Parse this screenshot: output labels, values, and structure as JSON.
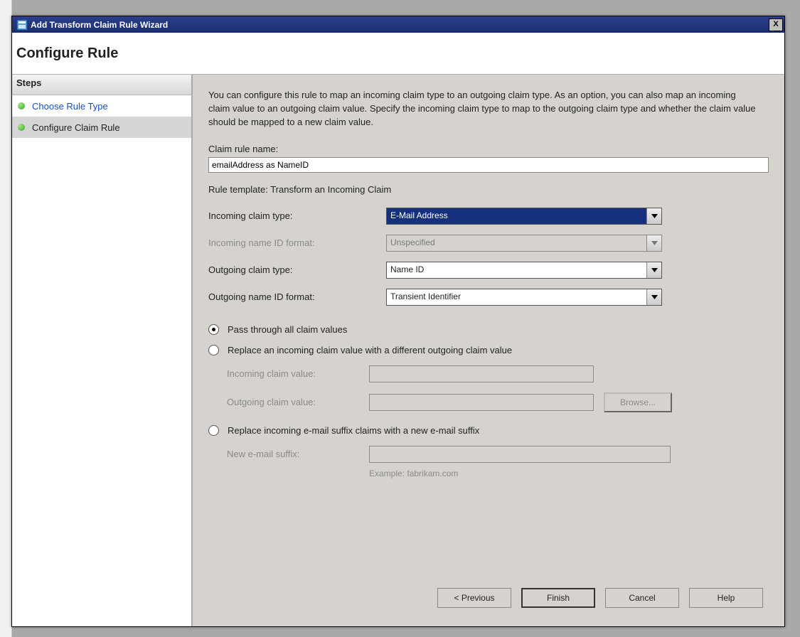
{
  "window": {
    "title": "Add Transform Claim Rule Wizard",
    "close_glyph": "X"
  },
  "header": {
    "title": "Configure Rule"
  },
  "sidebar": {
    "heading": "Steps",
    "items": [
      {
        "label": "Choose Rule Type"
      },
      {
        "label": "Configure Claim Rule"
      }
    ]
  },
  "main": {
    "intro": "You can configure this rule to map an incoming claim type to an outgoing claim type. As an option, you can also map an incoming claim value to an outgoing claim value. Specify the incoming claim type to map to the outgoing claim type and whether the claim value should be mapped to a new claim value.",
    "rule_name_label": "Claim rule name:",
    "rule_name_value": "emailAddress as NameID",
    "template_line": "Rule template: Transform an Incoming Claim",
    "incoming_type_label": "Incoming claim type:",
    "incoming_type_value": "E-Mail Address",
    "incoming_format_label": "Incoming name ID format:",
    "incoming_format_value": "Unspecified",
    "outgoing_type_label": "Outgoing claim type:",
    "outgoing_type_value": "Name ID",
    "outgoing_format_label": "Outgoing name ID format:",
    "outgoing_format_value": "Transient Identifier",
    "radios": {
      "pass": "Pass through all claim values",
      "replace_value": "Replace an incoming claim value with a different outgoing claim value",
      "replace_suffix": "Replace incoming e-mail suffix claims with a new e-mail suffix"
    },
    "replace": {
      "incoming_label": "Incoming claim value:",
      "outgoing_label": "Outgoing claim value:",
      "browse_label": "Browse..."
    },
    "suffix": {
      "label": "New e-mail suffix:",
      "example": "Example: fabrikam.com"
    }
  },
  "buttons": {
    "previous": "< Previous",
    "finish": "Finish",
    "cancel": "Cancel",
    "help": "Help"
  }
}
